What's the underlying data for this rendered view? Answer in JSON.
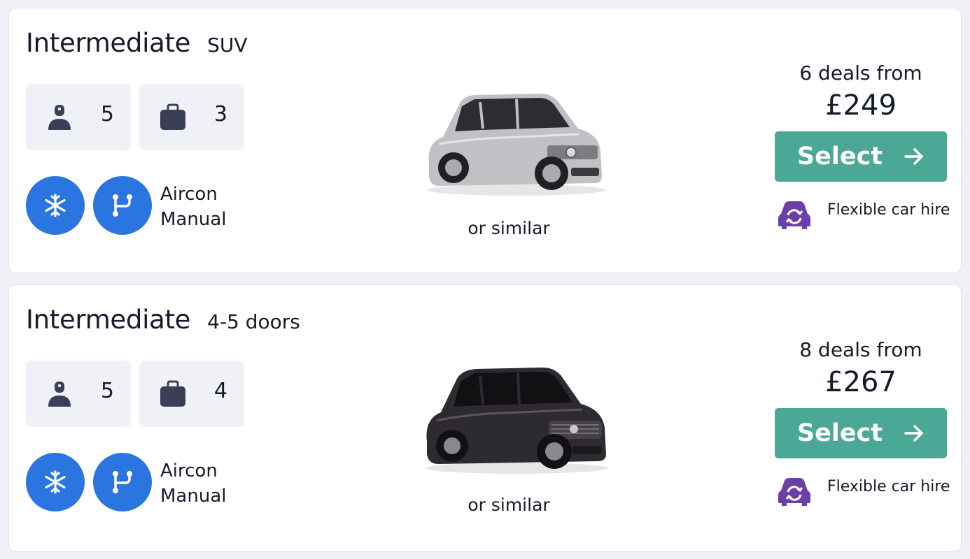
{
  "cards": [
    {
      "class_name": "Intermediate",
      "car_type": "SUV",
      "seats": "5",
      "bags": "3",
      "features": [
        "Aircon",
        "Manual"
      ],
      "image_caption": "or similar",
      "car_color": "silver",
      "deals_text": "6 deals from",
      "price": "£249",
      "select_label": "Select",
      "flex_label": "Flexible car hire"
    },
    {
      "class_name": "Intermediate",
      "car_type": "4-5 doors",
      "seats": "5",
      "bags": "4",
      "features": [
        "Aircon",
        "Manual"
      ],
      "image_caption": "or similar",
      "car_color": "dark-grey",
      "deals_text": "8 deals from",
      "price": "£267",
      "select_label": "Select",
      "flex_label": "Flexible car hire"
    }
  ],
  "colors": {
    "select_button": "#4ca896",
    "feature_circle": "#2a75e0",
    "flex_icon": "#6b3fa8",
    "spec_box": "#f0f1f6",
    "spec_icon": "#3b3e57"
  },
  "icons": {
    "seats": "person-icon",
    "bags": "suitcase-icon",
    "aircon": "snowflake-icon",
    "transmission": "gearshift-icon",
    "select": "arrow-right-icon",
    "flex": "flexible-car-icon"
  }
}
